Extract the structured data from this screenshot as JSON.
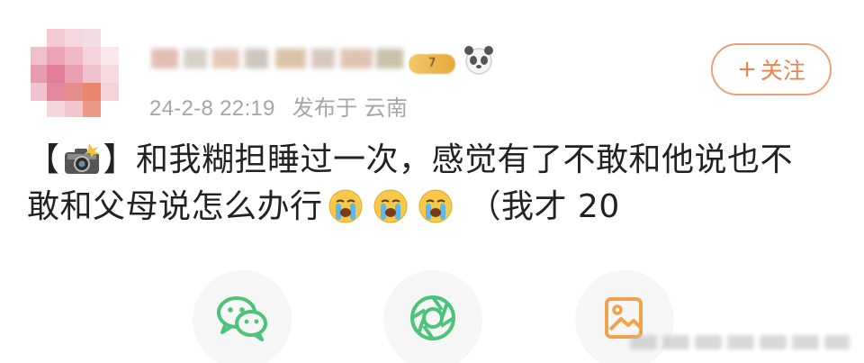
{
  "post": {
    "username_blurred": true,
    "vip_level": "7",
    "meta": {
      "time": "24-2-8 22:19",
      "published_from": "发布于 云南"
    },
    "follow_button": {
      "plus": "+",
      "label": "关注"
    },
    "content": {
      "bracket_open": "【",
      "bracket_close": "】",
      "line1": "和我糊担睡过一次，感觉有了不敢和他说也不",
      "line2": "敢和父母说怎么办行",
      "tail": "（我才 20"
    }
  },
  "share": {
    "buttons": [
      {
        "name": "wechat",
        "icon": "wechat-icon"
      },
      {
        "name": "moments",
        "icon": "moments-icon"
      },
      {
        "name": "save-image",
        "icon": "image-icon"
      }
    ]
  },
  "colors": {
    "accent": "#e8834e",
    "meta_text": "#a6a6a6",
    "wechat_green": "#4cc27a",
    "image_orange": "#f0a34a"
  }
}
